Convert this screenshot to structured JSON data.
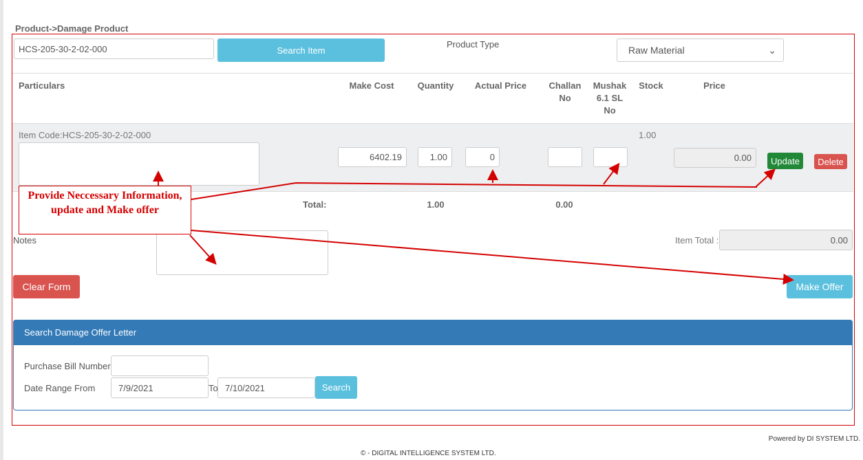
{
  "breadcrumb": "Product->Damage Product",
  "search": {
    "value": "HCS-205-30-2-02-000",
    "button": "Search Item"
  },
  "product_type": {
    "label": "Product Type",
    "selected": "Raw Material"
  },
  "table": {
    "headers": [
      "Particulars",
      "Make Cost",
      "Quantity",
      "Actual Price",
      "Challan No",
      "Mushak 6.1 SL No",
      "Stock",
      "Price"
    ],
    "row": {
      "item_code": "Item Code:HCS-205-30-2-02-000",
      "make_cost": "6402.19",
      "quantity": "1.00",
      "actual_price": "0",
      "challan_no": "",
      "mushak_no": "",
      "stock": "1.00",
      "price": "0.00",
      "update": "Update",
      "delete": "Delete"
    },
    "total_label": "Total:",
    "total_quantity": "1.00",
    "total_challan": "0.00"
  },
  "notes_label": "Notes",
  "item_total": {
    "label": "Item Total :",
    "value": "0.00"
  },
  "clear_form": "Clear Form",
  "make_offer": "Make Offer",
  "annotation": "Provide Neccessary Information, update and Make offer",
  "search_panel": {
    "title": "Search Damage Offer Letter",
    "bill_label": "Purchase Bill Number",
    "bill_value": "",
    "date_label": "Date Range From",
    "date_from": "7/9/2021",
    "to_label": "To",
    "date_to": "7/10/2021",
    "search": "Search"
  },
  "footer": {
    "powered": "Powered by DI SYSTEM LTD.",
    "copyright": "© - DIGITAL INTELLIGENCE SYSTEM LTD."
  },
  "colors": {
    "info": "#5bc0de",
    "danger": "#d9534f",
    "success": "#218838",
    "panel": "#337ab7",
    "annotation": "#d40000"
  }
}
